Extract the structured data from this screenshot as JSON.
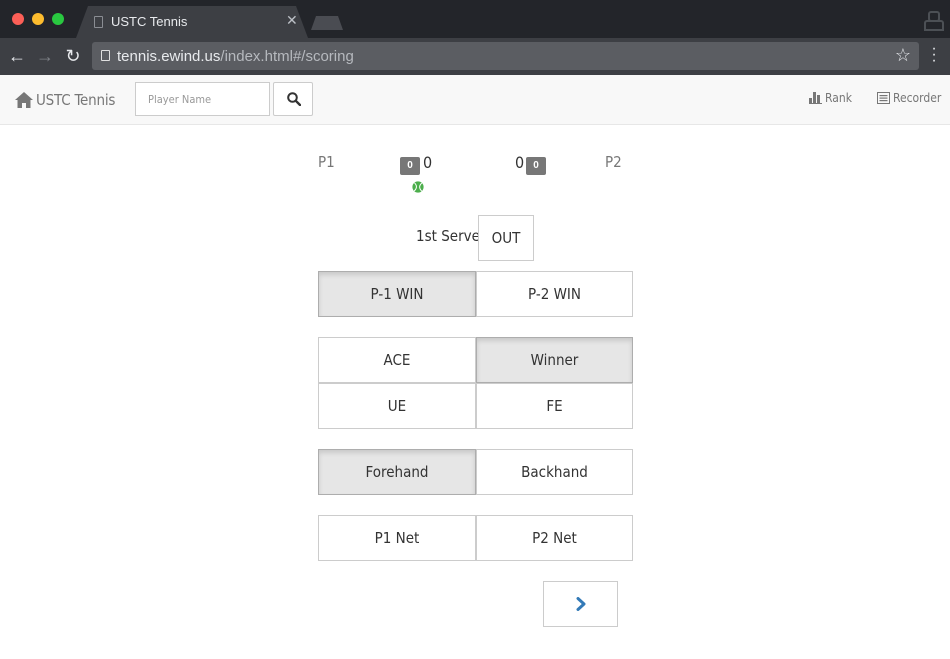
{
  "browser": {
    "tab_title": "USTC Tennis",
    "url_host": "tennis.ewind.us",
    "url_path": "/index.html#/scoring"
  },
  "navbar": {
    "brand": "USTC Tennis",
    "search_placeholder": "Player Name",
    "rank_label": "Rank",
    "recorder_label": "Recorder"
  },
  "score": {
    "p1_name": "P1",
    "p2_name": "P2",
    "p1_games": "0",
    "p2_games": "0",
    "p1_points": "0",
    "p2_points": "0",
    "server": "p1"
  },
  "serve": {
    "label": "1st Serve",
    "out_label": "OUT"
  },
  "winner_row": {
    "p1_win": "P-1 WIN",
    "p2_win": "P-2 WIN",
    "selected": "p1_win"
  },
  "shot_type": {
    "ace": "ACE",
    "winner": "Winner",
    "ue": "UE",
    "fe": "FE",
    "selected": "winner"
  },
  "stroke": {
    "forehand": "Forehand",
    "backhand": "Backhand",
    "selected": "forehand"
  },
  "net": {
    "p1_net": "P1 Net",
    "p2_net": "P2 Net"
  },
  "colors": {
    "active_bg": "#e6e6e6",
    "next_arrow": "#337ab7",
    "ball": "#4cae4c",
    "badge": "#777777"
  }
}
